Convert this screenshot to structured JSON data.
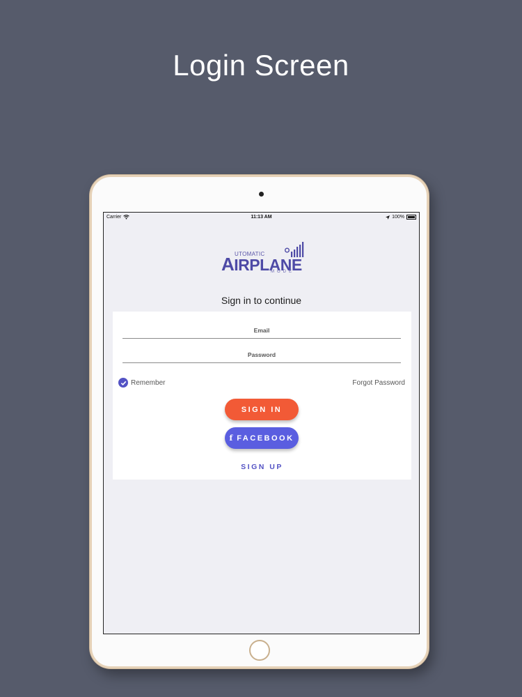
{
  "page": {
    "title": "Login Screen"
  },
  "status_bar": {
    "carrier": "Carrier",
    "time": "11:13 AM",
    "battery": "100%"
  },
  "logo": {
    "top": "UTOMATIC",
    "main_initial": "A",
    "main_rest": "IRPLANE",
    "bottom": "MODE"
  },
  "login": {
    "subtitle": "Sign in to continue",
    "email_placeholder": "Email",
    "password_placeholder": "Password",
    "remember_label": "Remember",
    "remember_checked": true,
    "forgot_label": "Forgot Password",
    "signin_label": "SIGN IN",
    "facebook_label": "FACEBOOK",
    "signup_label": "SIGN UP"
  },
  "colors": {
    "background": "#565b6b",
    "signin": "#f25a36",
    "facebook": "#5a5ee0",
    "accent": "#5352c4"
  },
  "icons": [
    "wifi-icon",
    "location-arrow-icon",
    "battery-icon",
    "checkmark-icon",
    "facebook-icon",
    "signal-bars-icon",
    "gear-icon"
  ]
}
